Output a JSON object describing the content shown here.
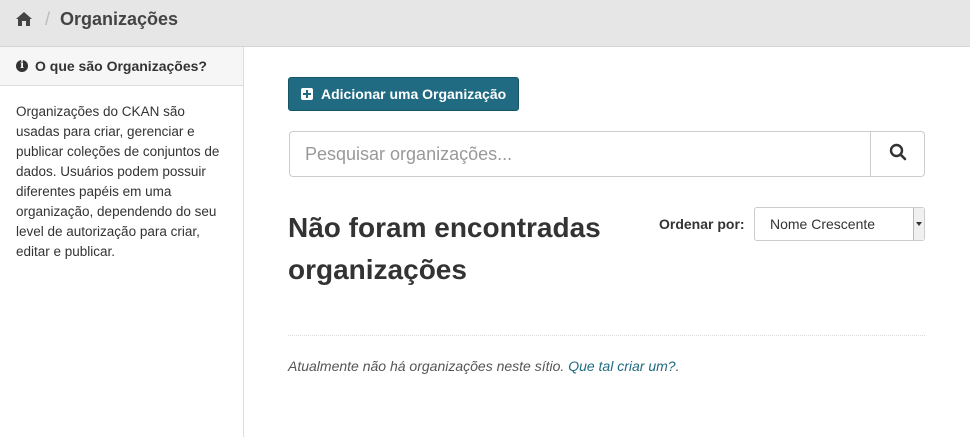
{
  "breadcrumb": {
    "current": "Organizações",
    "separator": "/"
  },
  "sidebar": {
    "title": "O que são Organizações?",
    "description": "Organizações do CKAN são usadas para criar, gerenciar e publicar coleções de conjuntos de dados. Usuários podem possuir diferentes papéis em uma organização, dependendo do seu level de autorização para criar, editar e publicar."
  },
  "main": {
    "add_button_label": "Adicionar uma Organização",
    "search": {
      "placeholder": "Pesquisar organizações...",
      "value": ""
    },
    "results_title": "Não foram encontradas organizações",
    "order_label": "Ordenar por:",
    "order_selected": "Nome Crescente",
    "empty_message": "Atualmente não há organizações neste sítio.",
    "empty_link": "Que tal criar um?",
    "empty_suffix": "."
  },
  "colors": {
    "accent": "#206b82",
    "topbar": "#e6e6e6",
    "background": "#eeeeee"
  },
  "icons": {
    "home": "home-icon",
    "info": "info-icon",
    "add": "plus-square-icon",
    "search": "search-icon",
    "select": "chevron-down-icon"
  }
}
